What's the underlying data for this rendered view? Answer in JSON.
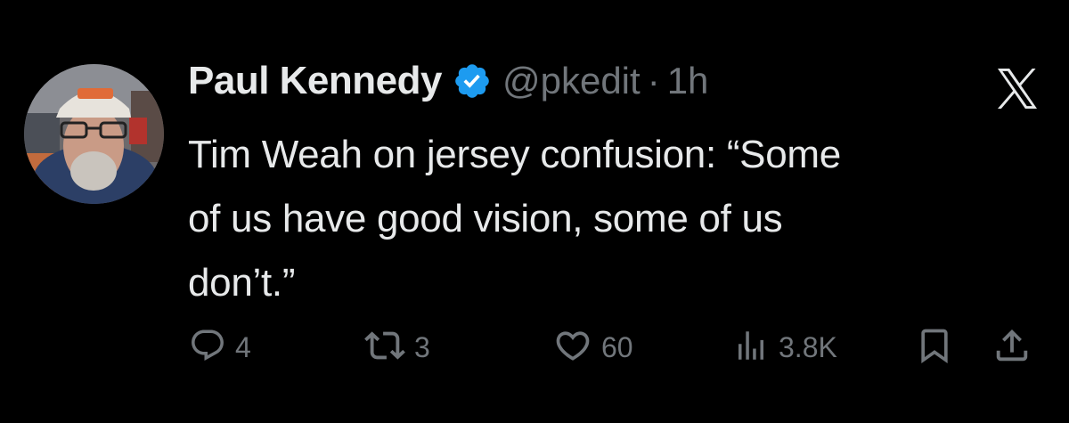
{
  "tweet": {
    "author_name": "Paul Kennedy",
    "handle": "@pkedit",
    "separator": "·",
    "time": "1h",
    "text_line1": "Tim Weah on jersey confusion: “Some",
    "text_line2": "of us have good vision, some of us",
    "text_line3": "don’t.”"
  },
  "actions": {
    "replies": "4",
    "retweets": "3",
    "likes": "60",
    "views": "3.8K"
  },
  "icons": {
    "avatar": "avatar-photo",
    "verified": "verified-badge-icon",
    "logo": "x-logo-icon",
    "reply": "reply-icon",
    "retweet": "retweet-icon",
    "like": "heart-icon",
    "views": "views-chart-icon",
    "bookmark": "bookmark-icon",
    "share": "share-icon"
  },
  "colors": {
    "background": "#000000",
    "text_primary": "#e7e9ea",
    "text_secondary": "#71767b",
    "verified_blue": "#1d9bf0"
  }
}
